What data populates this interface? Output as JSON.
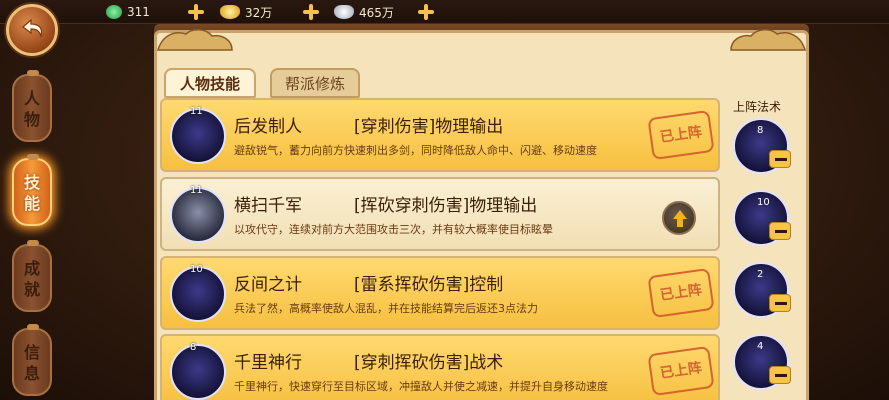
{
  "currency": {
    "jade": "311",
    "gold": "32万",
    "silver": "465万"
  },
  "left_tabs": [
    {
      "label": "人物",
      "active": false
    },
    {
      "label": "技能",
      "active": true
    },
    {
      "label": "成就",
      "active": false
    },
    {
      "label": "信息",
      "active": false
    }
  ],
  "tabs": {
    "skills": "人物技能",
    "guild": "帮派修炼"
  },
  "skills": [
    {
      "level": "11",
      "name": "后发制人",
      "type": "[穿刺伤害]物理输出",
      "desc": "避敌锐气，蓄力向前方快速刺出多剑，同时降低敌人命中、闪避、移动速度",
      "stamp": "已上阵"
    },
    {
      "level": "11",
      "name": "横扫千军",
      "type": "[挥砍穿刺伤害]物理输出",
      "desc": "以攻代守，连续对前方大范围攻击三次，并有较大概率使目标眩晕",
      "stamp": ""
    },
    {
      "level": "10",
      "name": "反间之计",
      "type": "[雷系挥砍伤害]控制",
      "desc": "兵法了然，高概率使敌人混乱，并在技能结算完后返还3点法力",
      "stamp": "已上阵"
    },
    {
      "level": "8",
      "name": "千里神行",
      "type": "[穿刺挥砍伤害]战术",
      "desc": "千里神行，快速穿行至目标区域，冲撞敌人并使之减速，并提升自身移动速度",
      "stamp": "已上阵"
    }
  ],
  "equipped": {
    "title": "上阵法术",
    "slots": [
      {
        "level": "8"
      },
      {
        "level": "10"
      },
      {
        "level": "2"
      },
      {
        "level": "4"
      }
    ]
  }
}
